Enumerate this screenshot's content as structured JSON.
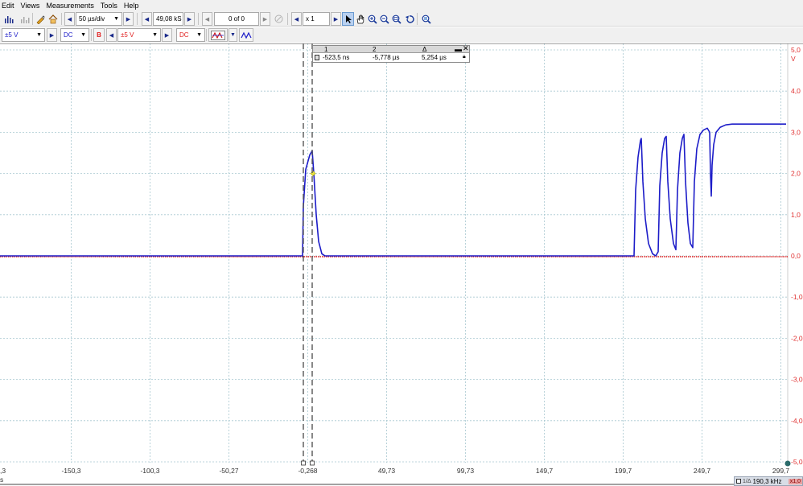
{
  "menu": {
    "items": [
      "Edit",
      "Views",
      "Measurements",
      "Tools",
      "Help"
    ]
  },
  "toolbar1": {
    "timebase": "50 µs/div",
    "samples": "49,08 kS",
    "buffer_position": "0 of 0",
    "zoom_factor": "x 1"
  },
  "toolbar2": {
    "channel_a_range": "±5 V",
    "channel_a_coupling": "DC",
    "channel_b_label": "B",
    "channel_b_range": "±5 V",
    "channel_b_coupling": "DC"
  },
  "ruler_panel": {
    "headers": [
      "1",
      "2",
      "Δ"
    ],
    "values": [
      "-523,5 ns",
      "-5,778 µs",
      "5,254 µs"
    ]
  },
  "axes": {
    "x_tick_labels": [
      "-150,3",
      "-100,3",
      "-50,27",
      "-0,268",
      "49,73",
      "99,73",
      "149,7",
      "199,7",
      "249,7",
      "299,7"
    ],
    "x_left_partial": ",3",
    "x_unit_partial": "s",
    "y_tick_labels": [
      "5,0",
      "4,0",
      "3,0",
      "2,0",
      "1,0",
      "0,0",
      "-1,0",
      "-2,0",
      "-3,0",
      "-4,0",
      "-5,0"
    ],
    "y_unit": "V"
  },
  "status": {
    "frequency": "190,3 kHz",
    "badge": "x1,0"
  },
  "colors": {
    "channel_a": "#1c1cc8",
    "channel_b": "#e02020",
    "grid": "#a8c8d0",
    "y_axis_text": "#e03030"
  }
}
